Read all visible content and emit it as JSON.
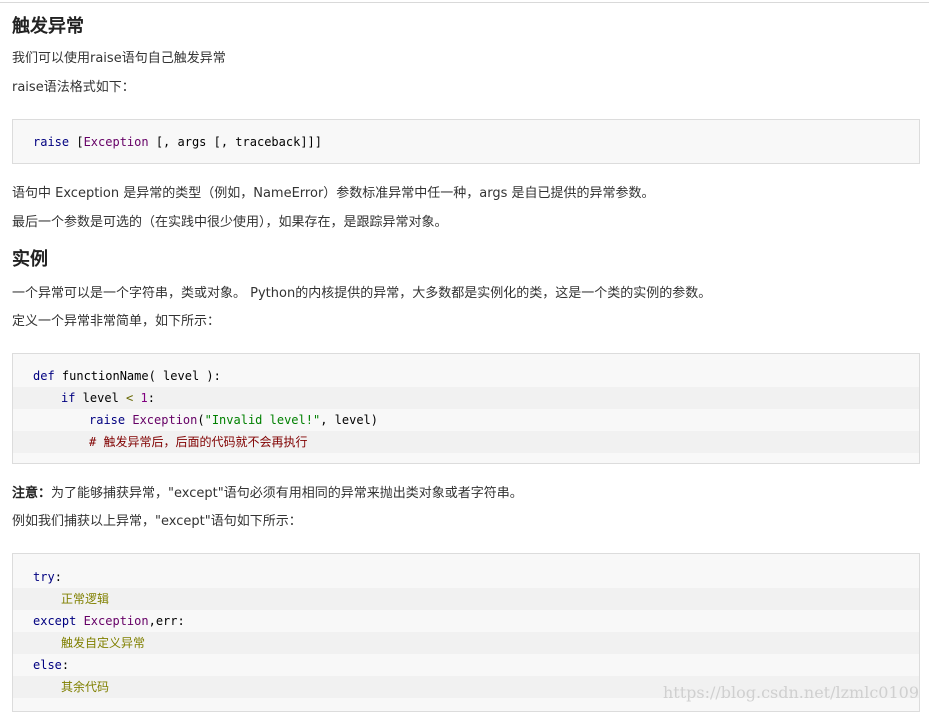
{
  "sections": {
    "trigger_title": "触发异常",
    "intro1": "我们可以使用raise语句自己触发异常",
    "intro2": "raise语法格式如下：",
    "code1": {
      "kw": "raise",
      "rest": " [",
      "cls": "Exception",
      "tail": " [, args [, traceback]]]"
    },
    "desc1": "语句中 Exception 是异常的类型（例如，NameError）参数标准异常中任一种，args 是自已提供的异常参数。",
    "desc2": "最后一个参数是可选的（在实践中很少使用），如果存在，是跟踪异常对象。",
    "example_title": "实例",
    "ex_text1": "一个异常可以是一个字符串，类或对象。 Python的内核提供的异常，大多数都是实例化的类，这是一个类的实例的参数。",
    "ex_text2": "定义一个异常非常简单，如下所示：",
    "code2": {
      "l1_kw": "def",
      "l1_fn": " functionName( level ):",
      "l2_kw": "if",
      "l2_mid": " level ",
      "l2_op": "<",
      "l2_num": " 1",
      "l2_end": ":",
      "l3_kw": "raise",
      "l3_cls": " Exception",
      "l3_p1": "(",
      "l3_str": "\"Invalid level!\"",
      "l3_p2": ", level)",
      "l4_cm": "# 触发异常后，后面的代码就不会再执行"
    },
    "note_label": "注意：",
    "note_text": "为了能够捕获异常，\"except\"语句必须有用相同的异常来抛出类对象或者字符串。",
    "catch_text": "例如我们捕获以上异常，\"except\"语句如下所示：",
    "code3": {
      "l1_kw": "try",
      "l1_end": ":",
      "l2": "正常逻辑",
      "l3_kw": "except",
      "l3_cls": " Exception",
      "l3_end": ",err:",
      "l4": "触发自定义异常",
      "l5_kw": "else",
      "l5_end": ":",
      "l6": "其余代码"
    }
  },
  "watermark": "https://blog.csdn.net/lzmlc0109"
}
